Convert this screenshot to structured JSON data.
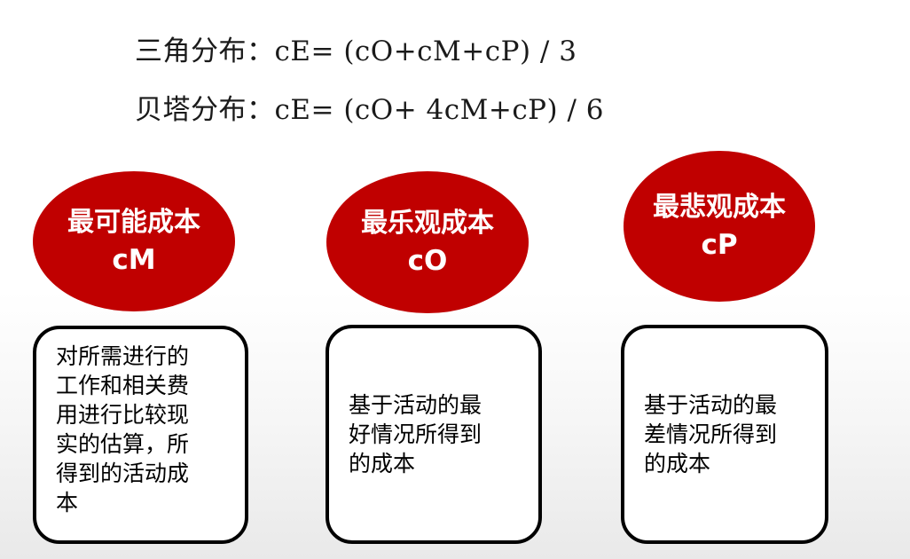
{
  "formulas": {
    "triangular": "三角分布：cE= (cO+cM+cP) / 3",
    "beta": "贝塔分布：cE= (cO+ 4cM+cP) / 6"
  },
  "estimates": [
    {
      "title": "最可能成本",
      "code": "cM",
      "description_lines": [
        "对所需进行的",
        "工作和相关费",
        "用进行比较现",
        "实的估算，所",
        "得到的活动成",
        "本"
      ]
    },
    {
      "title": "最乐观成本",
      "code": "cO",
      "description_lines": [
        "基于活动的最",
        "好情况所得到",
        "的成本"
      ]
    },
    {
      "title": "最悲观成本",
      "code": "cP",
      "description_lines": [
        "基于活动的最",
        "差情况所得到",
        "的成本"
      ]
    }
  ],
  "colors": {
    "ellipse_fill": "#c00000",
    "ellipse_text": "#ffffff",
    "box_border": "#000000"
  }
}
